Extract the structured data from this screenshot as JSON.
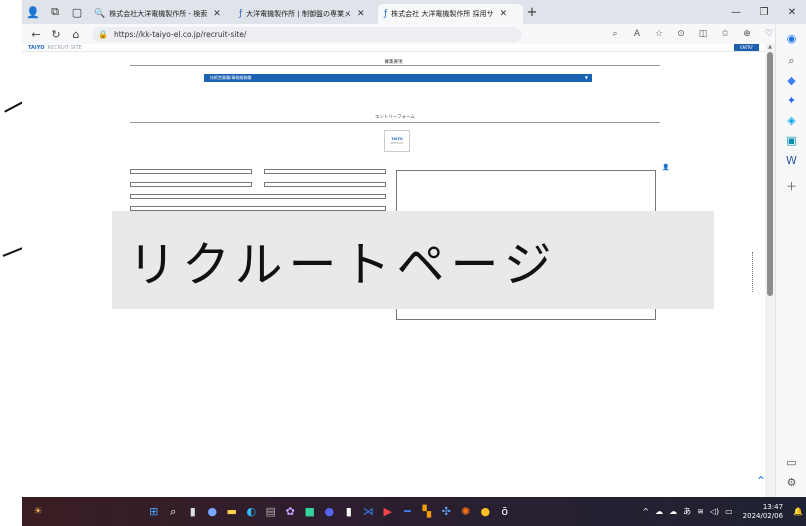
{
  "browser": {
    "tabs": [
      {
        "label": "株式会社大洋電機製作所 - 検索",
        "icon": "search-icon",
        "active": false
      },
      {
        "label": "大洋電機製作所 | 制御盤の専業メ",
        "icon": "site-icon",
        "active": false
      },
      {
        "label": "株式会社 大洋電機製作所 採用サ",
        "icon": "site-icon",
        "active": true
      }
    ],
    "new_tab": "+",
    "url": "https://kk-taiyo-el.co.jp/recruit-site/"
  },
  "page": {
    "section_title": "募集要項",
    "dropdown_label": "技術営業職/事務総務職",
    "form_title": "エントリーフォーム",
    "logo_text": "TAIYO",
    "logo_sub": "RECRUIT",
    "site_logo": "TAIYO",
    "site_logo_sub": "RECRUIT SITE",
    "site_button": "ENTRY",
    "overlay_text": "リクルートページ"
  },
  "taskbar": {
    "time": "13:47",
    "date": "2024/02/06",
    "ime": "あ"
  },
  "colors": {
    "accent": "#1c62b3",
    "tabbar": "#dfe3ea",
    "taskbar": "#2c1e2e"
  }
}
